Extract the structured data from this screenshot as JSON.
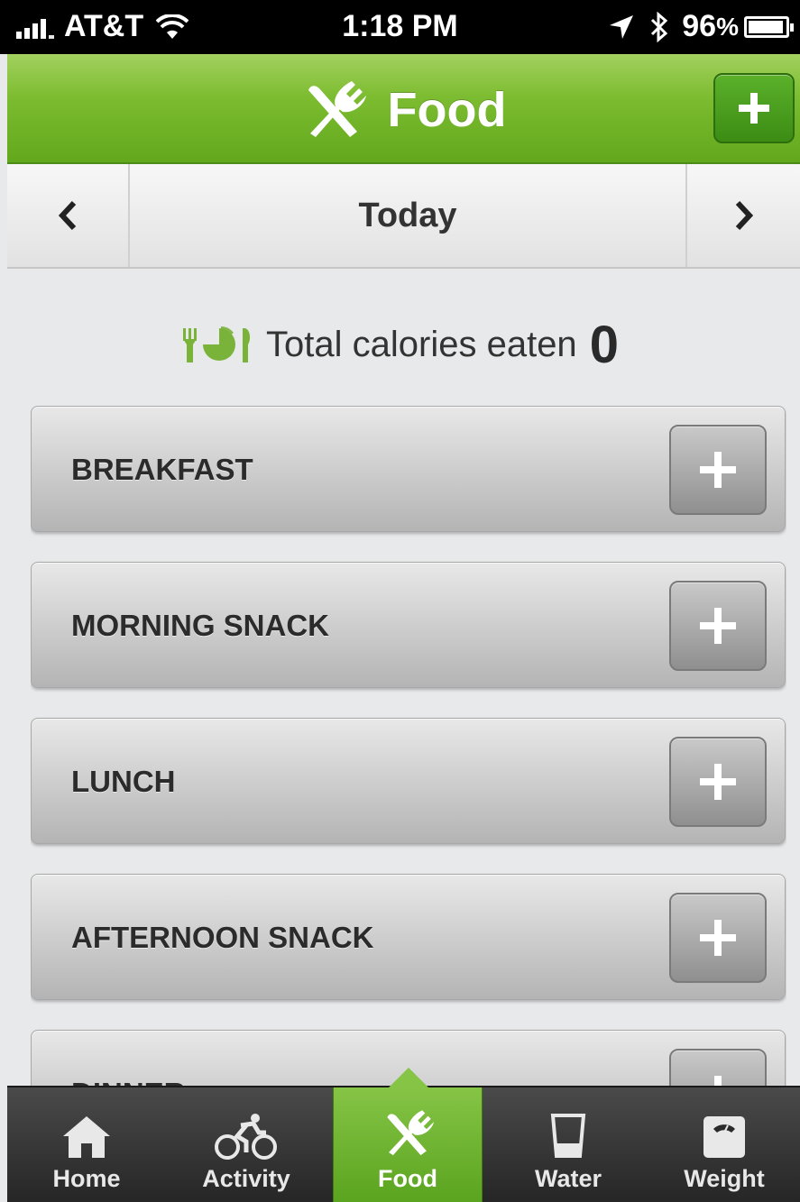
{
  "status_bar": {
    "carrier": "AT&T",
    "time": "1:18 PM",
    "battery_level": "96",
    "battery_suffix": "%",
    "battery_fraction": 0.96,
    "icons": [
      "signal-icon",
      "wifi-icon",
      "location-arrow-icon",
      "bluetooth-icon",
      "battery-icon"
    ]
  },
  "header": {
    "title": "Food",
    "icon": "fork-knife-icon",
    "add_icon": "plus-icon",
    "color": "#7cbc30"
  },
  "date_nav": {
    "label": "Today",
    "prev_icon": "chevron-left-icon",
    "next_icon": "chevron-right-icon"
  },
  "summary": {
    "label": "Total calories eaten",
    "value": "0",
    "icon": "plate-pie-icon",
    "icon_color": "#7ab33a"
  },
  "meals": [
    {
      "name": "BREAKFAST"
    },
    {
      "name": "MORNING SNACK"
    },
    {
      "name": "LUNCH"
    },
    {
      "name": "AFTERNOON SNACK"
    },
    {
      "name": "DINNER"
    }
  ],
  "tab_bar": {
    "tabs": [
      {
        "label": "Home",
        "icon": "home-icon"
      },
      {
        "label": "Activity",
        "icon": "cyclist-icon"
      },
      {
        "label": "Food",
        "icon": "fork-knife-icon",
        "active": true
      },
      {
        "label": "Water",
        "icon": "glass-icon"
      },
      {
        "label": "Weight",
        "icon": "scale-icon"
      }
    ],
    "active_color": "#6fb532"
  }
}
